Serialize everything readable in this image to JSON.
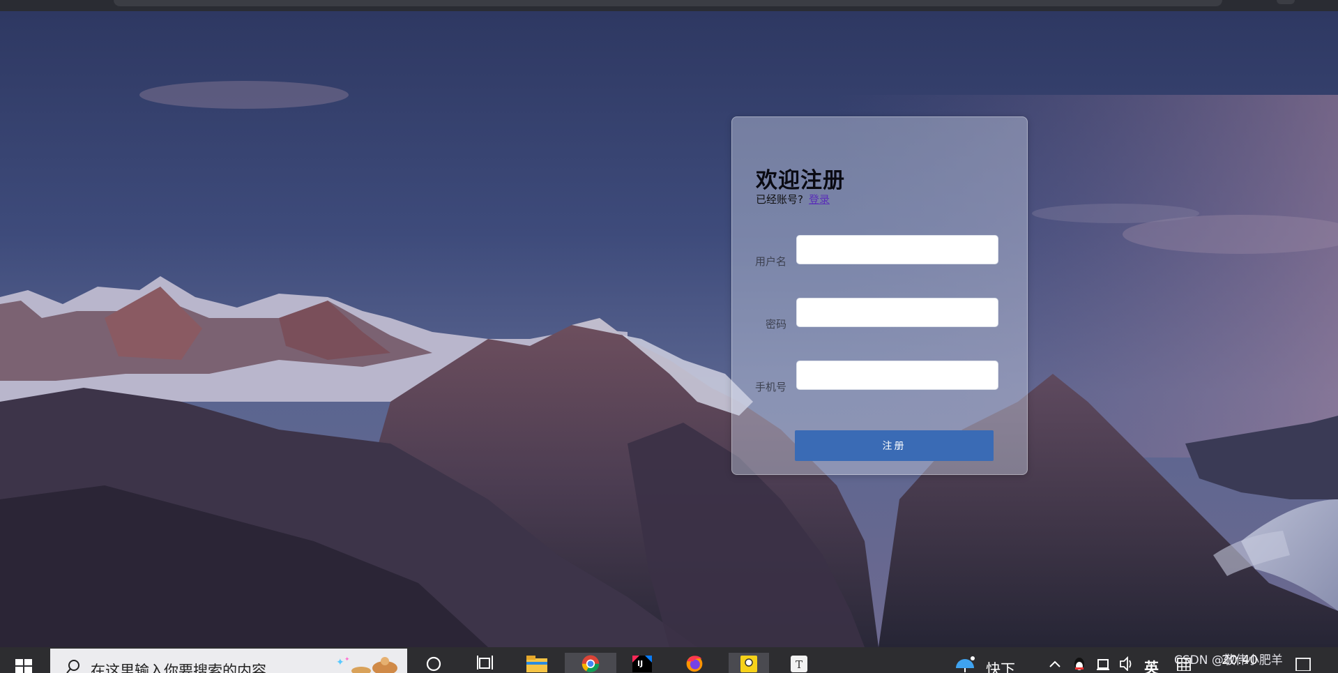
{
  "form": {
    "title": "欢迎注册",
    "subtitle_text": "已经账号?",
    "login_link": "登录",
    "fields": [
      {
        "label": "用户名",
        "value": ""
      },
      {
        "label": "密码",
        "value": ""
      },
      {
        "label": "手机号",
        "value": ""
      }
    ],
    "submit_label": "注册"
  },
  "taskbar": {
    "search_placeholder": "在这里输入你要搜索的内容",
    "weather_text": "快下",
    "ime_indicator": "英",
    "clock": "20:40",
    "icons": [
      "windows-start-icon",
      "search-icon",
      "cortana-icon",
      "task-view-icon",
      "file-explorer-icon",
      "chrome-icon",
      "intellij-idea-icon",
      "firefox-icon",
      "sticky-notes-icon",
      "typora-icon",
      "weather-icon",
      "tray-chevron-icon",
      "qq-icon",
      "network-icon",
      "volume-icon",
      "ime-icon",
      "notification-icon"
    ]
  },
  "watermark": "CSDN @敬伟小肥羊",
  "colors": {
    "accent_button": "#3a6bb5",
    "link": "#5a2fb8",
    "taskbar_bg": "#2d2d30"
  }
}
